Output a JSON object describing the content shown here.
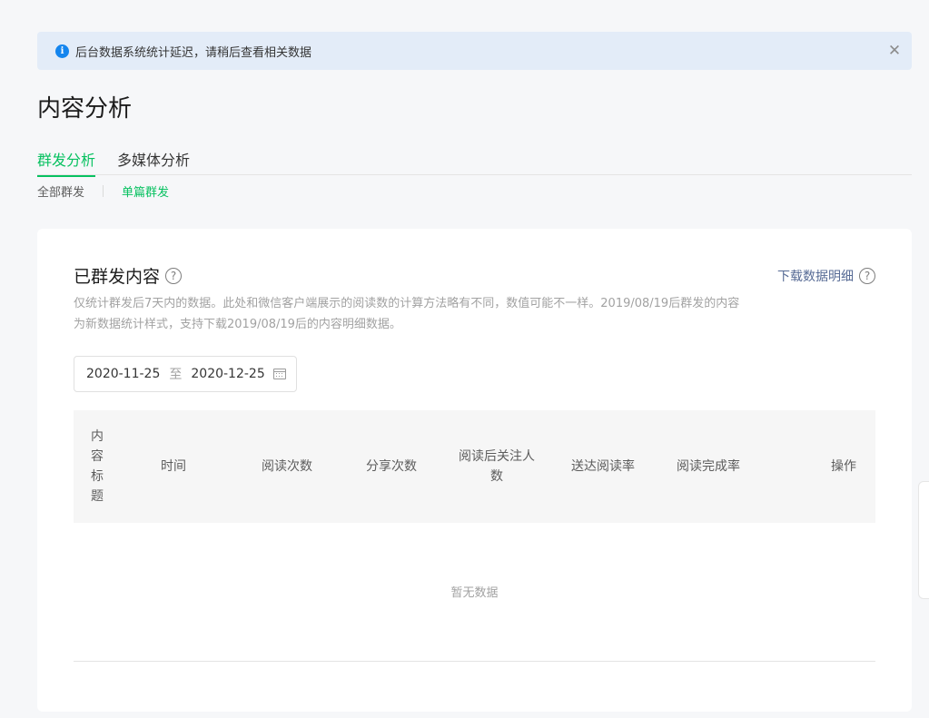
{
  "notice": {
    "text": "后台数据系统统计延迟，请稍后查看相关数据",
    "icon": "info-icon",
    "close_icon": "close-icon"
  },
  "page": {
    "title": "内容分析"
  },
  "tabs": [
    {
      "label": "群发分析",
      "active": true
    },
    {
      "label": "多媒体分析",
      "active": false
    }
  ],
  "subtabs": [
    {
      "label": "全部群发",
      "active": false
    },
    {
      "label": "单篇群发",
      "active": true
    }
  ],
  "section": {
    "title": "已群发内容",
    "download_label": "下载数据明细",
    "description": "仅统计群发后7天内的数据。此处和微信客户端展示的阅读数的计算方法略有不同，数值可能不一样。2019/08/19后群发的内容为新数据统计样式，支持下载2019/08/19后的内容明细数据。"
  },
  "date_range": {
    "start": "2020-11-25",
    "separator": "至",
    "end": "2020-12-25"
  },
  "table": {
    "headers": [
      "内容标题",
      "时间",
      "阅读次数",
      "分享次数",
      "阅读后关注人数",
      "送达阅读率",
      "阅读完成率",
      "操作"
    ],
    "empty_text": "暂无数据"
  },
  "colors": {
    "accent": "#07c160",
    "link": "#576b95",
    "notice_bg": "#e3ecf8"
  }
}
